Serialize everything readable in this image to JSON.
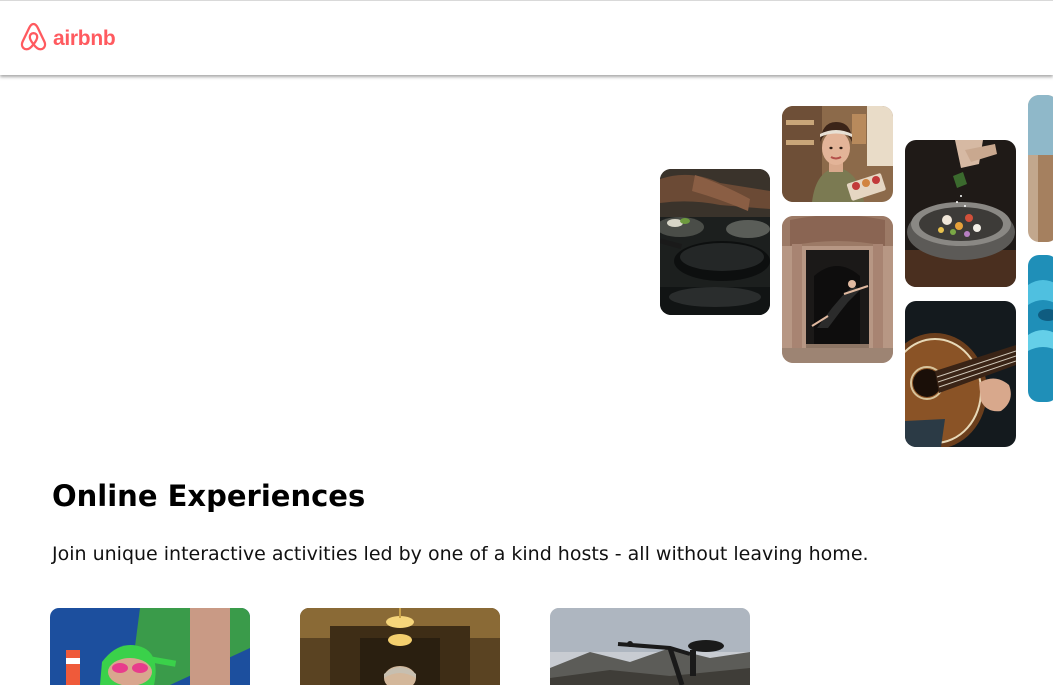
{
  "navbar": {
    "logo_text": "airbnb",
    "logo_icon": "airbnb-belo-icon",
    "brand_color": "#ff5a5f"
  },
  "hero": {
    "photos": [
      {
        "subject": "people cooking with pans"
      },
      {
        "subject": "woman in kitchen holding cookie box"
      },
      {
        "subject": "dancer leaping in ornate doorway"
      },
      {
        "subject": "hand seasoning a bowl of food"
      },
      {
        "subject": "hands playing acoustic guitar"
      },
      {
        "subject": "outdoor scene, partially visible"
      },
      {
        "subject": "blue water pool, partially visible"
      }
    ]
  },
  "section": {
    "title": "Online Experiences",
    "subtitle": "Join unique interactive activities led by one of a kind hosts - all without leaving home."
  },
  "cards": [
    {
      "subject": "swimmer with green cap and pink goggles"
    },
    {
      "subject": "person in a lit hallway"
    },
    {
      "subject": "mountain bike against hills"
    }
  ]
}
